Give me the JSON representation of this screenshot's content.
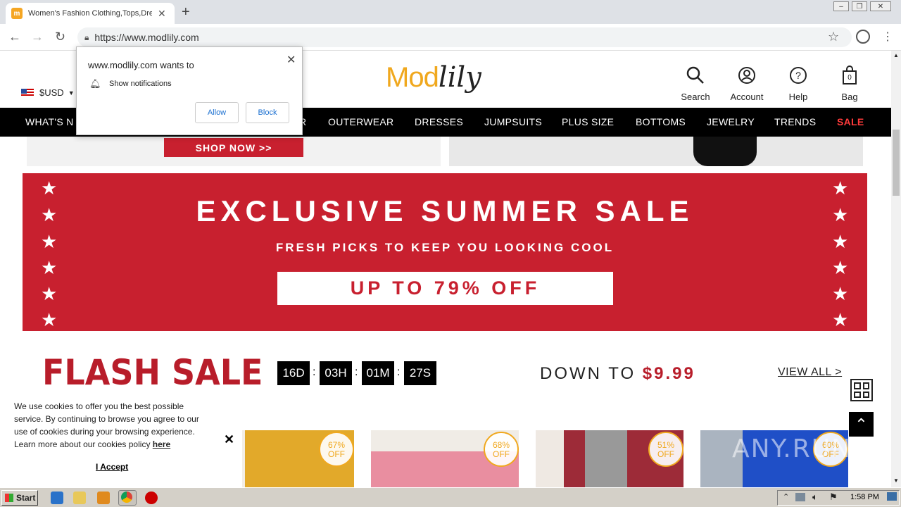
{
  "browser": {
    "tab_title": "Women's Fashion Clothing,Tops,Dre",
    "url": "https://www.modlily.com"
  },
  "notification_popup": {
    "title": "www.modlily.com wants to",
    "message": "Show notifications",
    "allow_label": "Allow",
    "block_label": "Block"
  },
  "header": {
    "currency": "$USD",
    "logo_mod": "Mod",
    "logo_lily": "lily",
    "icons": [
      {
        "label": "Search",
        "icon": "search-icon"
      },
      {
        "label": "Account",
        "icon": "account-icon"
      },
      {
        "label": "Help",
        "icon": "help-icon"
      },
      {
        "label": "Bag",
        "icon": "bag-icon",
        "count": "0"
      }
    ]
  },
  "nav": {
    "items": [
      "WHAT'S N",
      "R",
      "OUTERWEAR",
      "DRESSES",
      "JUMPSUITS",
      "PLUS SIZE",
      "BOTTOMS",
      "JEWELRY",
      "TRENDS",
      "SALE"
    ],
    "sale_color": "#ff3b3b"
  },
  "top_banner": {
    "shop_now": "SHOP NOW >>"
  },
  "summer_banner": {
    "title": "EXCLUSIVE SUMMER SALE",
    "subtitle": "FRESH PICKS TO KEEP YOU LOOKING COOL",
    "cta": "UP TO 79% OFF",
    "color": "#c8202f"
  },
  "flash_sale": {
    "title": "FLASH SALE",
    "countdown": [
      "16D",
      "03H",
      "01M",
      "27S"
    ],
    "separator": ":",
    "down_to_label": "DOWN TO",
    "down_to_price": "$9.99",
    "view_all": "VIEW ALL >"
  },
  "products": [
    {
      "discount": "67%",
      "off": "OFF"
    },
    {
      "discount": "68%",
      "off": "OFF"
    },
    {
      "discount": "51%",
      "off": "OFF"
    },
    {
      "discount": "60%",
      "off": "OFF"
    }
  ],
  "cookie": {
    "text": "We use cookies to offer you the best possible service. By continuing to browse you agree to our use of cookies during your browsing experience. Learn more about our cookies policy",
    "link": "here",
    "accept": "I Accept",
    "close": "✕"
  },
  "taskbar": {
    "start": "Start",
    "clock": "1:58 PM"
  },
  "watermark": "ANY.RUN"
}
